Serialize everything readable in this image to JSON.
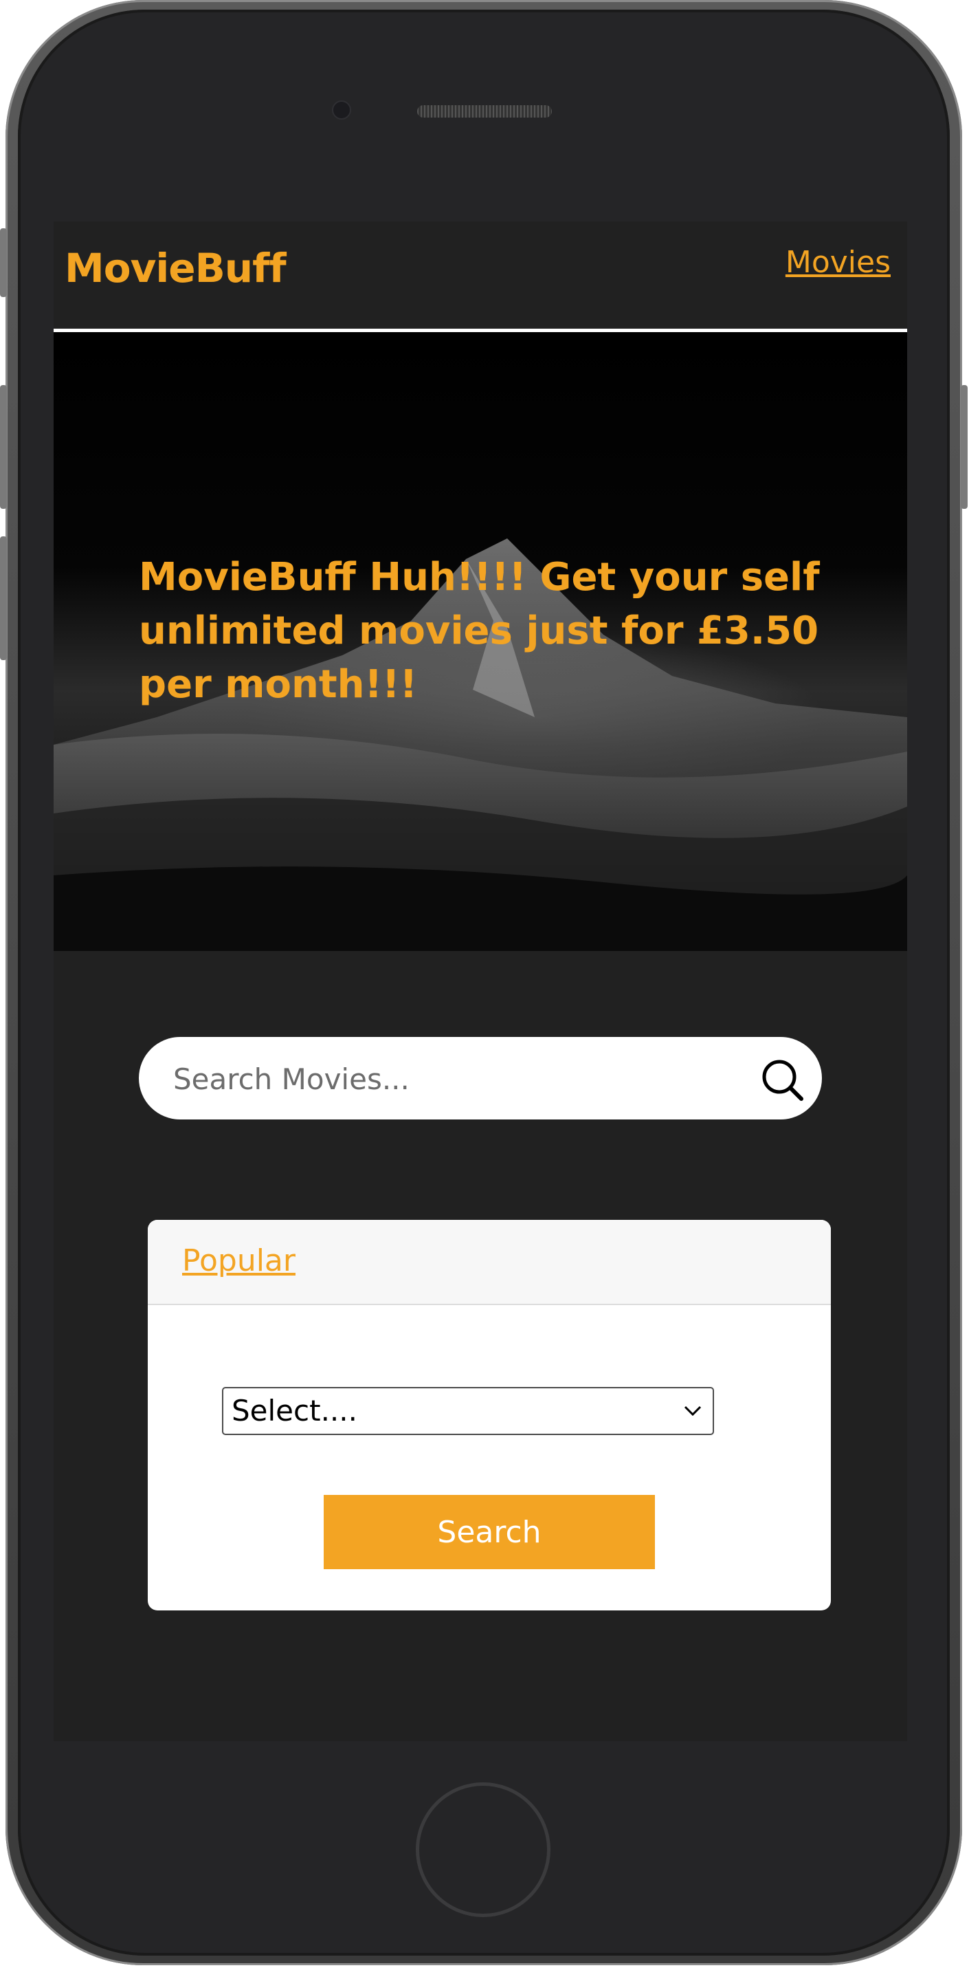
{
  "navbar": {
    "brand": "MovieBuff",
    "link_movies": "Movies"
  },
  "hero": {
    "headline": "MovieBuff Huh!!!! Get your self unlimited movies just for £3.50 per month!!!"
  },
  "search": {
    "placeholder": "Search Movies...",
    "icon": "search-icon"
  },
  "card": {
    "tab_label": "Popular",
    "select_value": "Select....",
    "button_label": "Search"
  },
  "colors": {
    "accent": "#f3a423",
    "background": "#212121",
    "card": "#ffffff"
  }
}
